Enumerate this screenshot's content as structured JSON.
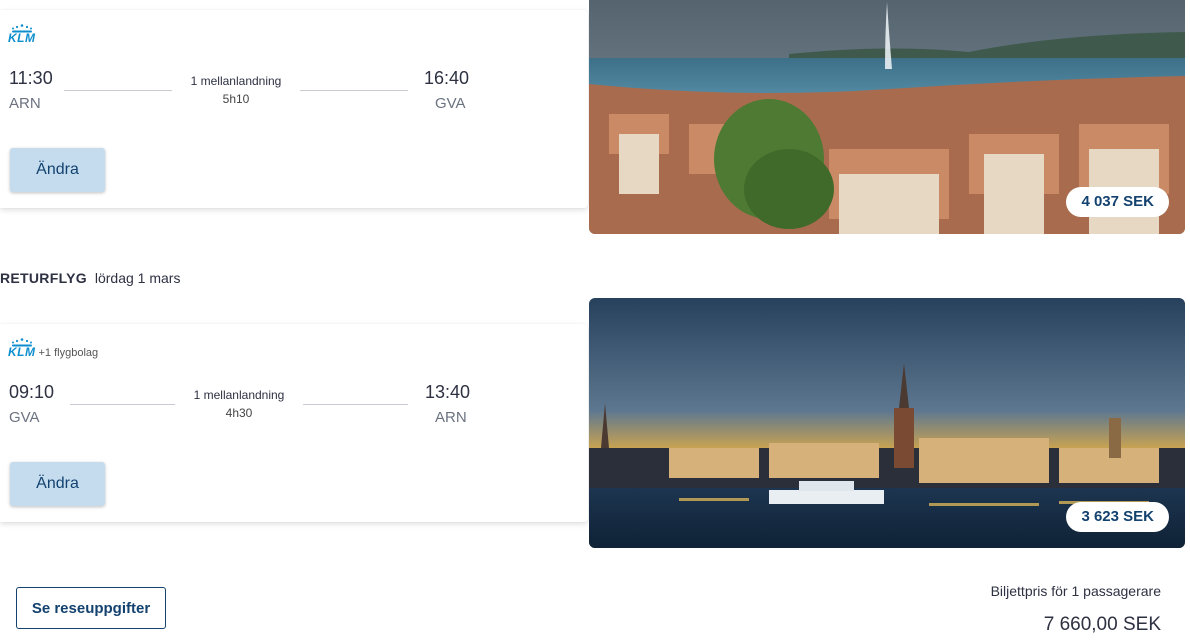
{
  "outbound": {
    "airline": "KLM",
    "extra_airlines": "",
    "depart_time": "11:30",
    "depart_code": "ARN",
    "stops": "1 mellanlandning",
    "duration": "5h10",
    "arrive_time": "16:40",
    "arrive_code": "GVA",
    "change_label": "Ändra",
    "price": "4 037 SEK"
  },
  "return_header": {
    "label": "RETURFLYG",
    "date": "lördag 1 mars"
  },
  "return": {
    "airline": "KLM",
    "extra_airlines": "+1 flygbolag",
    "depart_time": "09:10",
    "depart_code": "GVA",
    "stops": "1 mellanlandning",
    "duration": "4h30",
    "arrive_time": "13:40",
    "arrive_code": "ARN",
    "change_label": "Ändra",
    "price": "3 623 SEK"
  },
  "footer": {
    "details_label": "Se reseuppgifter",
    "price_label": "Biljettpris för 1 passagerare",
    "total": "7 660,00 SEK"
  },
  "colors": {
    "accent": "#13426f",
    "button_bg": "#c4dcee",
    "klm_blue": "#0e8ece"
  }
}
